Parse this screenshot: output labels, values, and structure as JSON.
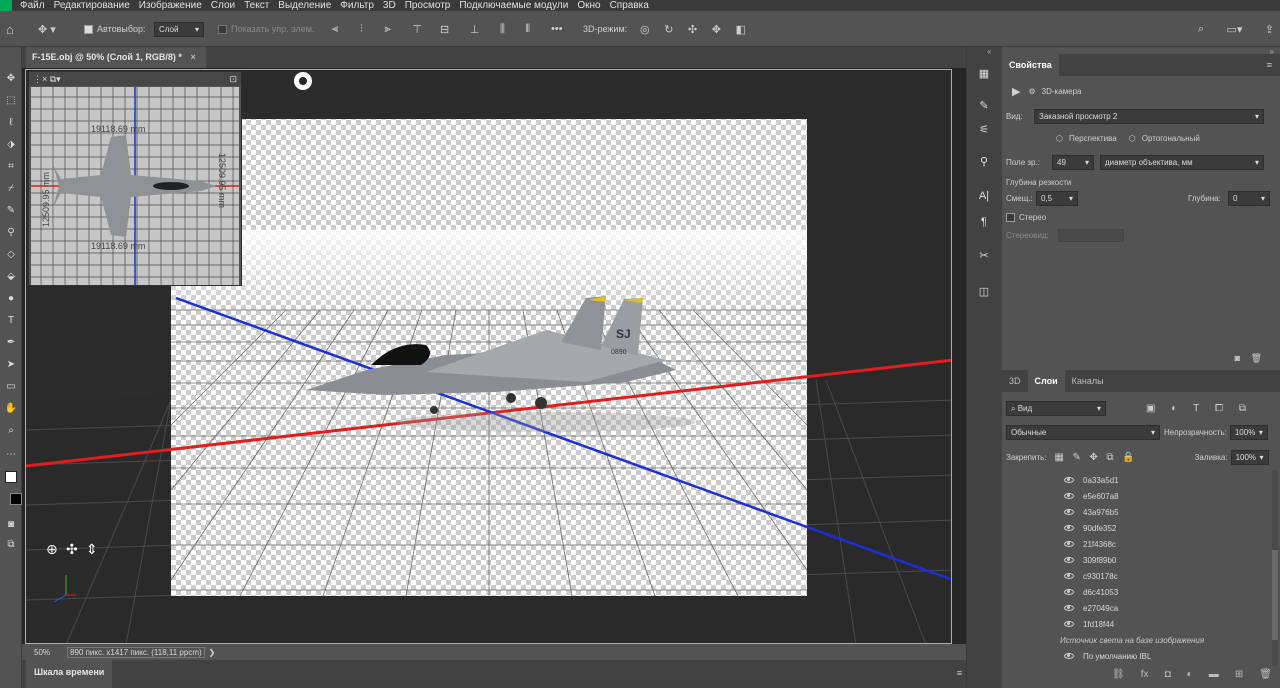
{
  "menu": [
    "Файл",
    "Редактирование",
    "Изображение",
    "Слои",
    "Текст",
    "Выделение",
    "Фильтр",
    "3D",
    "Просмотр",
    "Подключаемые модули",
    "Окно",
    "Справка"
  ],
  "options": {
    "autoselect_label": "Автовыбор:",
    "autoselect_value": "Слой",
    "show_controls_label": "Показать упр. элем.",
    "mode3d_label": "3D-режим:"
  },
  "document": {
    "tab_title": "F-15E.obj @ 50% (Слой 1, RGB/8) *",
    "zoom": "50%",
    "info": "890 пикс. x1417 пикс. (118,11 ppcm)"
  },
  "minimap": {
    "dim_top": "19118.69 mm",
    "dim_bottom": "19118.69 mm",
    "dim_left": "12509.95 mm",
    "dim_right": "12509.95 mm"
  },
  "model": {
    "tail_code": "SJ",
    "tail_number": "0890"
  },
  "timeline_label": "Шкала времени",
  "properties": {
    "tab": "Свойства",
    "camera_label": "3D-камера",
    "view_label": "Вид:",
    "view_value": "Заказной просмотр 2",
    "perspective": "Перспектива",
    "orthographic": "Ортогональный",
    "fov_label": "Поле зр.:",
    "fov_value": "49",
    "lens_value": "диаметр объектива, мм",
    "dof_label": "Глубина резкости",
    "offset_label": "Смещ.:",
    "offset_value": "0,5",
    "depth_label": "Глубина:",
    "depth_value": "0",
    "stereo_label": "Стерео",
    "stereo_view_label": "Стереовид:"
  },
  "layers": {
    "tabs": [
      "3D",
      "Слои",
      "Каналы"
    ],
    "filter_label": "Вид",
    "blend_mode": "Обычные",
    "opacity_label": "Непрозрачность:",
    "opacity_value": "100%",
    "lock_label": "Закрепить:",
    "fill_label": "Заливка:",
    "fill_value": "100%",
    "items": [
      "0a33a5d1",
      "e5e607a8",
      "43a976b5",
      "90dfe352",
      "21f4368c",
      "309f89b0",
      "c930178c",
      "d6c41053",
      "e27049ca",
      "1fd18f44"
    ],
    "ibl_label": "Источник света на базе изображения",
    "default_ibl": "По умолчанию IBL"
  },
  "colors": {
    "accent_yellow": "#d7b023",
    "axis_red": "#e11d1d",
    "axis_blue": "#1a2fd8",
    "panel_bg": "#535353"
  }
}
